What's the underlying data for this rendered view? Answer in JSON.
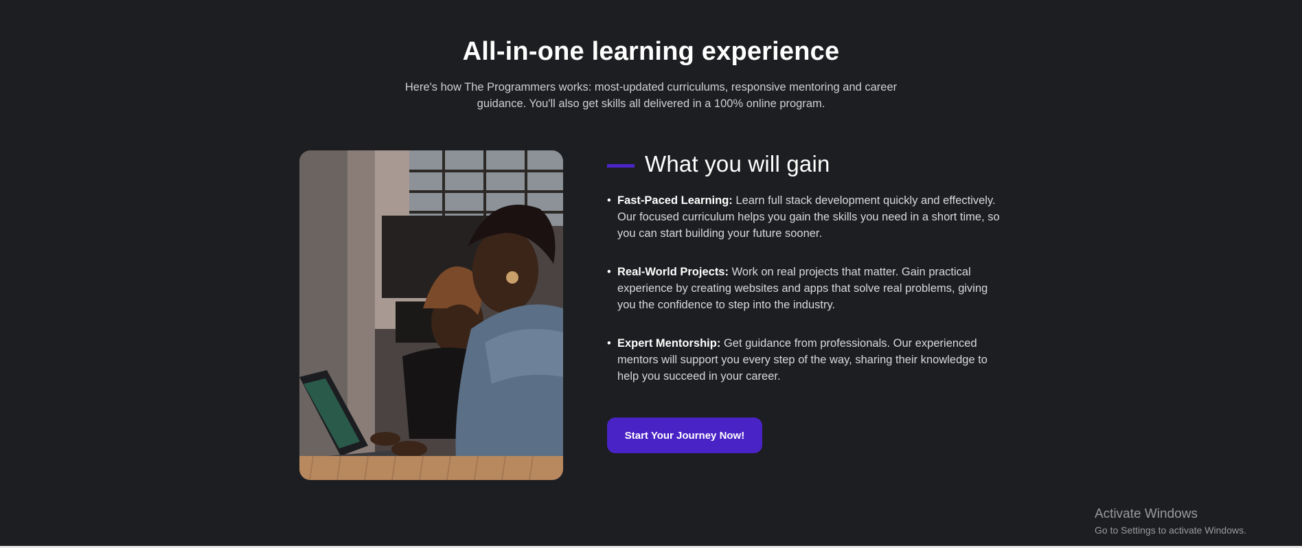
{
  "header": {
    "title": "All-in-one learning experience",
    "subtitle": "Here's how The Programmers works: most-updated curriculums, responsive mentoring and career guidance. You'll also get skills all delivered in a 100% online program."
  },
  "gain": {
    "title": "What you will gain",
    "accent_color": "#4b25c9",
    "items": [
      {
        "bullet": "•",
        "lead": "Fast-Paced Learning:",
        "text": "Learn full stack development quickly and effectively. Our focused curriculum helps you gain the skills you need in a short time, so you can start building your future sooner."
      },
      {
        "bullet": "•",
        "lead": "Real-World Projects:",
        "text": "Work on real projects that matter. Gain practical experience by creating websites and apps that solve real problems, giving you the confidence to step into the industry."
      },
      {
        "bullet": "•",
        "lead": "Expert Mentorship:",
        "text": "Get guidance from professionals. Our experienced mentors will support you every step of the way, sharing their knowledge to help you succeed in your career."
      }
    ]
  },
  "cta": {
    "label": "Start Your Journey Now!",
    "color": "#4a23c6"
  },
  "watermark": {
    "title": "Activate Windows",
    "subtitle": "Go to Settings to activate Windows."
  },
  "colors": {
    "background": "#1d1e21",
    "text": "#ffffff",
    "muted_text": "#cfd0d4"
  }
}
